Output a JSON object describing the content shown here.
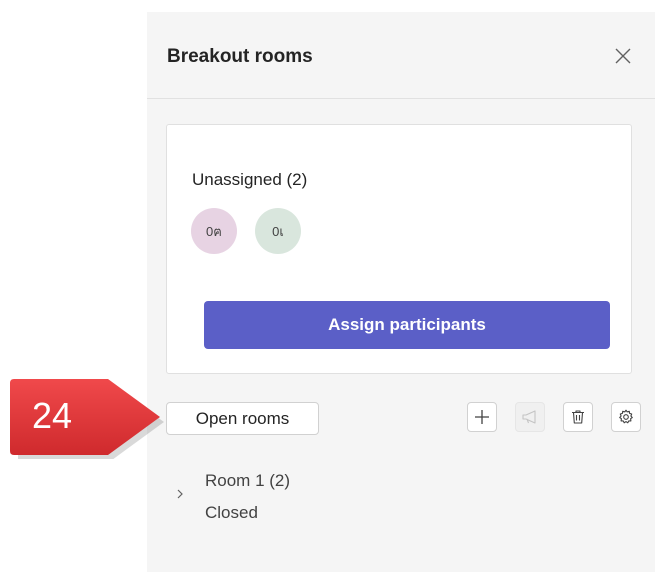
{
  "panel": {
    "title": "Breakout rooms",
    "close_icon": "close-icon"
  },
  "unassigned": {
    "title": "Unassigned (2)",
    "avatars": [
      {
        "initials": "0ฅ",
        "color": "#e7d3e3"
      },
      {
        "initials": "0เ",
        "color": "#d9e6dd"
      }
    ],
    "assign_label": "Assign participants",
    "assign_color": "#5b5fc7"
  },
  "toolbar": {
    "open_rooms_label": "Open rooms",
    "icons": [
      "add-icon",
      "announcement-icon",
      "delete-icon",
      "settings-icon"
    ]
  },
  "rooms": [
    {
      "name": "Room 1 (2)",
      "status": "Closed"
    }
  ],
  "callout": {
    "number": "24",
    "color": "#e8373a"
  }
}
